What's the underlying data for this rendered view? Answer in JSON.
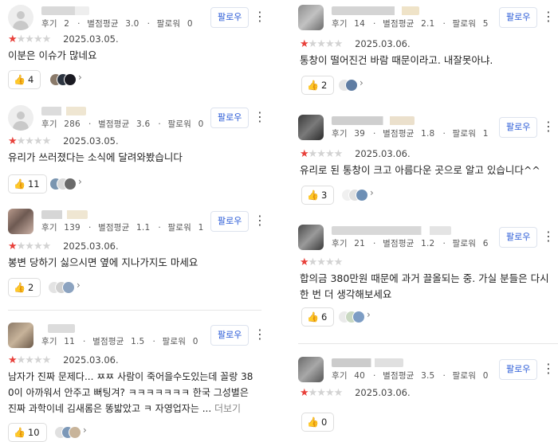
{
  "follow_label": "팔로우",
  "more_label": "더보기",
  "labels": {
    "reviews": "후기",
    "avg_rating": "별점평균",
    "followers": "팔로워"
  },
  "colors": {
    "star_active": "#e8413b",
    "star_inactive": "#d3d3d3",
    "follow_text": "#2a5bd7"
  },
  "icons": {
    "like": "thumbs-up-icon",
    "menu": "kebab-menu-icon",
    "avatar_default": "default-profile-icon",
    "chevron": "chevron-right-icon"
  },
  "reviews": [
    {
      "reviews": "2",
      "avg": "3.0",
      "followers": "0",
      "rating": 1,
      "date": "2025.03.05.",
      "text": [
        "이분은 이슈가 많네요"
      ],
      "likes": "4"
    },
    {
      "reviews": "286",
      "avg": "3.6",
      "followers": "0",
      "rating": 1,
      "date": "2025.03.05.",
      "text": [
        "유리가 쓰러졌다는 소식에 달려와봤습니다"
      ],
      "likes": "11"
    },
    {
      "reviews": "139",
      "avg": "1.1",
      "followers": "1",
      "rating": 1,
      "date": "2025.03.06.",
      "text": [
        "봉변 당하기 싫으시면 옆에 지나가지도 마세요"
      ],
      "likes": "2"
    },
    {
      "reviews": "11",
      "avg": "1.5",
      "followers": "0",
      "rating": 1,
      "date": "2025.03.06.",
      "text": [
        "남자가 진짜 문제다... ㅉㅉ 사람이 죽어을수도있는데 꼴랑 38",
        "0이 아까워서 안주고 뻐팅겨? ㅋㅋㅋㅋㅋㅋㅋ 한국 그성별은",
        "진짜 과학이네 김새롬은 똥밟았고 ㅋ 자영업자는 ..."
      ],
      "likes": "10"
    },
    {
      "reviews": "14",
      "avg": "2.1",
      "followers": "5",
      "rating": 1,
      "date": "2025.03.06.",
      "text": [
        "통창이 떨어진건 바람 때문이라고. 내잘못아냐."
      ],
      "likes": "2"
    },
    {
      "reviews": "39",
      "avg": "1.8",
      "followers": "1",
      "rating": 1,
      "date": "2025.03.06.",
      "text": [
        "유리로 된 통창이 크고 아름다운 곳으로 알고 있습니다^^"
      ],
      "likes": "3"
    },
    {
      "reviews": "21",
      "avg": "1.2",
      "followers": "6",
      "rating": 1,
      "date": "2025.03.06.",
      "text": [
        "합의금 380만원 때문에 과거 끌올되는 중. 가실 분들은 다시",
        "한 번 더 생각해보세요"
      ],
      "likes": "6"
    },
    {
      "reviews": "40",
      "avg": "3.5",
      "followers": "0",
      "rating": 1,
      "date": "2025.03.06.",
      "text": [],
      "likes": "0"
    }
  ]
}
